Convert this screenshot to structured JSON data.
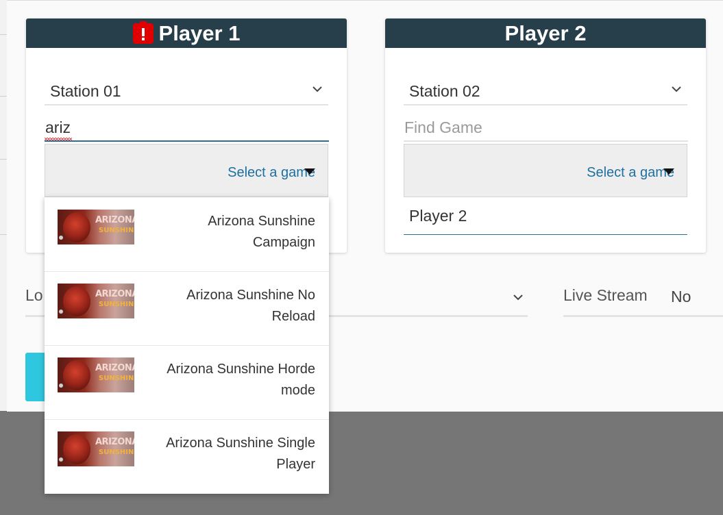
{
  "player1": {
    "title": "Player 1",
    "station": "Station 01",
    "search_value": "ariz",
    "game_select_label": "Select a game"
  },
  "player2": {
    "title": "Player 2",
    "station": "Station 02",
    "search_placeholder": "Find Game",
    "game_select_label": "Select a game",
    "player_name": "Player 2"
  },
  "location": {
    "label_partial": "Lo"
  },
  "live_stream": {
    "label": "Live Stream",
    "value": "No"
  },
  "dropdown": {
    "items": [
      {
        "name": "Arizona Sunshine Campaign"
      },
      {
        "name": "Arizona Sunshine No Reload"
      },
      {
        "name": "Arizona Sunshine Horde mode"
      },
      {
        "name": "Arizona Sunshine Single Player"
      }
    ],
    "thumb_text_top": "ARIZONA",
    "thumb_text_bottom": "SUNSHINE"
  },
  "colors": {
    "header": "#263f4b",
    "accent": "#2a6e95",
    "link": "#1d6fa0",
    "alert": "#e00000",
    "button": "#2ec7df"
  },
  "icons": {
    "alert": "alert-icon",
    "chevron": "chevron-down-icon",
    "caret": "caret-down-icon"
  }
}
